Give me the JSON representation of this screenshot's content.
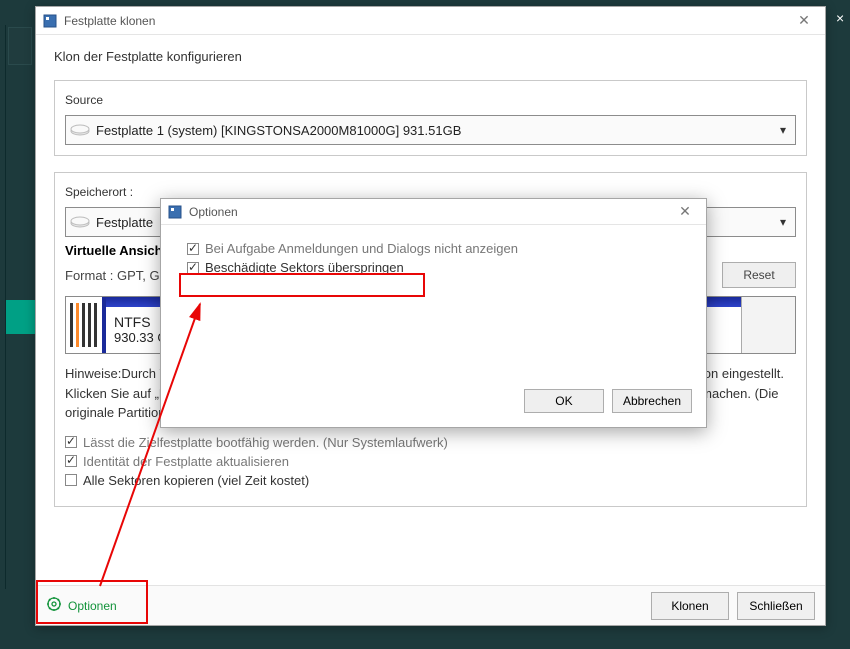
{
  "window": {
    "title": "Festplatte klonen",
    "subtitle": "Klon der Festplatte konfigurieren"
  },
  "source": {
    "label": "Source",
    "selected": "Festplatte 1 (system) [KINGSTONSA2000M81000G]   931.51GB"
  },
  "dest": {
    "label": "Speicherort :",
    "selected_prefix": "Festplatte"
  },
  "virtual": {
    "heading": "Virtuelle Ansicht",
    "format_prefix": "Format : GPT,  G",
    "reset": "Reset",
    "ntfs_label": "NTFS",
    "ntfs_size": "930.33 G"
  },
  "hint": "Hinweise:Durch Verschieben der Bearbeitungspunkte mit der Maus können die Größe und Position jeder Partition eingestellt. Klicken Sie auf „Freiraum \", um neue Partition zu erstellen. Klicken Sie noch mal, um Erstellung rückgängig zu machen. (Die originale Partition kann nicht gelöscht)",
  "checks": {
    "bootable": "Lässt die Zielfestplatte bootfähig werden. (Nur Systemlaufwerk)",
    "identity": "Identität der Festplatte aktualisieren",
    "allsectors": "Alle Sektoren kopieren (viel Zeit kostet)"
  },
  "footer": {
    "options": "Optionen",
    "clone": "Klonen",
    "close": "Schließen"
  },
  "options_dialog": {
    "title": "Optionen",
    "opt_suppress": "Bei Aufgabe Anmeldungen und Dialogs nicht anzeigen",
    "opt_skipbad": "Beschädigte Sektors überspringen",
    "ok": "OK",
    "cancel": "Abbrechen"
  }
}
